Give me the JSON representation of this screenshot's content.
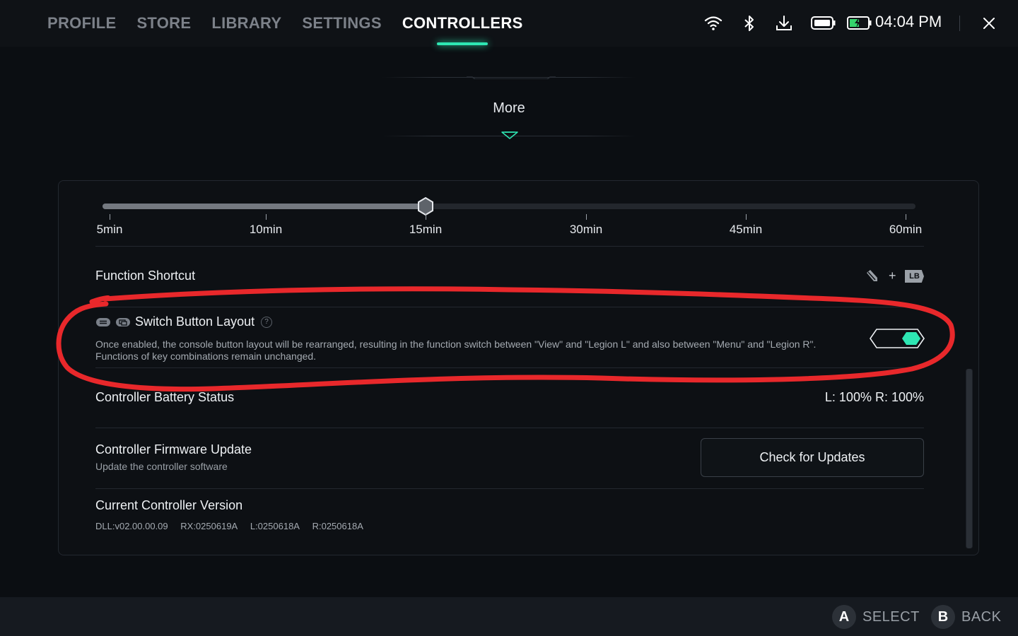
{
  "nav": {
    "tabs": [
      {
        "label": "PROFILE"
      },
      {
        "label": "STORE"
      },
      {
        "label": "LIBRARY"
      },
      {
        "label": "SETTINGS"
      },
      {
        "label": "CONTROLLERS"
      }
    ],
    "active_tab": "CONTROLLERS"
  },
  "status": {
    "icons": [
      "wifi-icon",
      "bluetooth-icon",
      "download-icon",
      "controller-battery-icon",
      "device-battery-icon"
    ],
    "time": "04:04 PM",
    "close_icon": "close-icon"
  },
  "more": {
    "label": "More"
  },
  "sleep_slider": {
    "options": [
      "5min",
      "10min",
      "15min",
      "30min",
      "45min",
      "60min"
    ],
    "selected": "15min"
  },
  "function_shortcut": {
    "title": "Function Shortcut",
    "keys": {
      "plus": "+",
      "lb": "LB"
    }
  },
  "switch_layout": {
    "title": "Switch Button Layout",
    "help": "?",
    "description": "Once enabled, the console button layout will be rearranged, resulting in the function switch between \"View\" and \"Legion L\" and also between \"Menu\" and \"Legion R\". Functions of key combinations remain unchanged.",
    "enabled": true
  },
  "battery": {
    "title": "Controller Battery Status",
    "value": "L: 100% R: 100%"
  },
  "firmware": {
    "title": "Controller Firmware Update",
    "subtitle": "Update the controller software",
    "button": "Check for Updates"
  },
  "version": {
    "title": "Current Controller Version",
    "dll": "DLL:v02.00.00.09",
    "rx": "RX:0250619A",
    "l": "L:0250618A",
    "r": "R:0250618A"
  },
  "footer": {
    "select": {
      "key": "A",
      "label": "SELECT"
    },
    "back": {
      "key": "B",
      "label": "BACK"
    }
  },
  "colors": {
    "accent": "#2ee6b3",
    "background": "#0b0e12",
    "annotation": "#e8282b"
  }
}
